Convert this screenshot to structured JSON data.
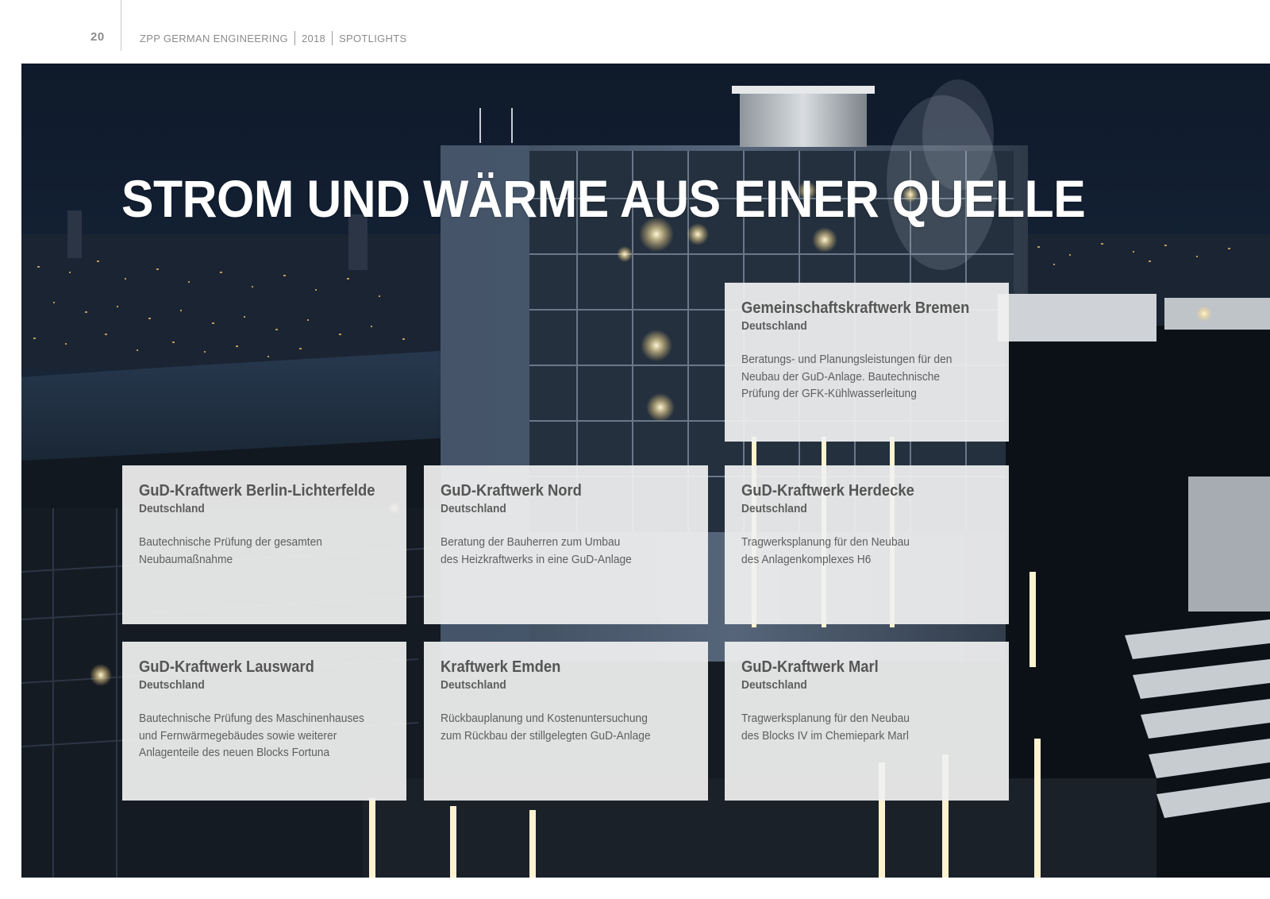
{
  "header": {
    "page_number": "20",
    "brand": "ZPP GERMAN ENGINEERING",
    "year": "2018",
    "section": "SPOTLIGHTS"
  },
  "headline": "STROM UND WÄRME AUS EINER QUELLE",
  "projects": [
    {
      "title": "Gemeinschaftskraftwerk Bremen",
      "country": "Deutschland",
      "description": "Beratungs- und Planungsleistungen für den\nNeubau der GuD-Anlage. Bautechnische\nPrüfung der GFK-Kühlwasserleitung"
    },
    {
      "title": "GuD-Kraftwerk Berlin-Lichterfelde",
      "country": "Deutschland",
      "description": "Bautechnische Prüfung der gesamten\nNeubaumaßnahme"
    },
    {
      "title": "GuD-Kraftwerk Nord",
      "country": "Deutschland",
      "description": "Beratung der Bauherren zum Umbau\ndes Heizkraftwerks in eine GuD-Anlage"
    },
    {
      "title": "GuD-Kraftwerk Herdecke",
      "country": "Deutschland",
      "description": "Tragwerksplanung für den Neubau\ndes Anlagenkomplexes H6"
    },
    {
      "title": "GuD-Kraftwerk Lausward",
      "country": "Deutschland",
      "description": "Bautechnische Prüfung des Maschinenhauses\nund Fernwärmegebäudes sowie weiterer\nAnlagenteile des neuen Blocks Fortuna"
    },
    {
      "title": "Kraftwerk Emden",
      "country": "Deutschland",
      "description": "Rückbauplanung und Kostenuntersuchung\nzum Rückbau der stillgelegten GuD-Anlage"
    },
    {
      "title": "GuD-Kraftwerk Marl",
      "country": "Deutschland",
      "description": "Tragwerksplanung für den Neubau\ndes Blocks IV im Chemiepark Marl"
    }
  ]
}
